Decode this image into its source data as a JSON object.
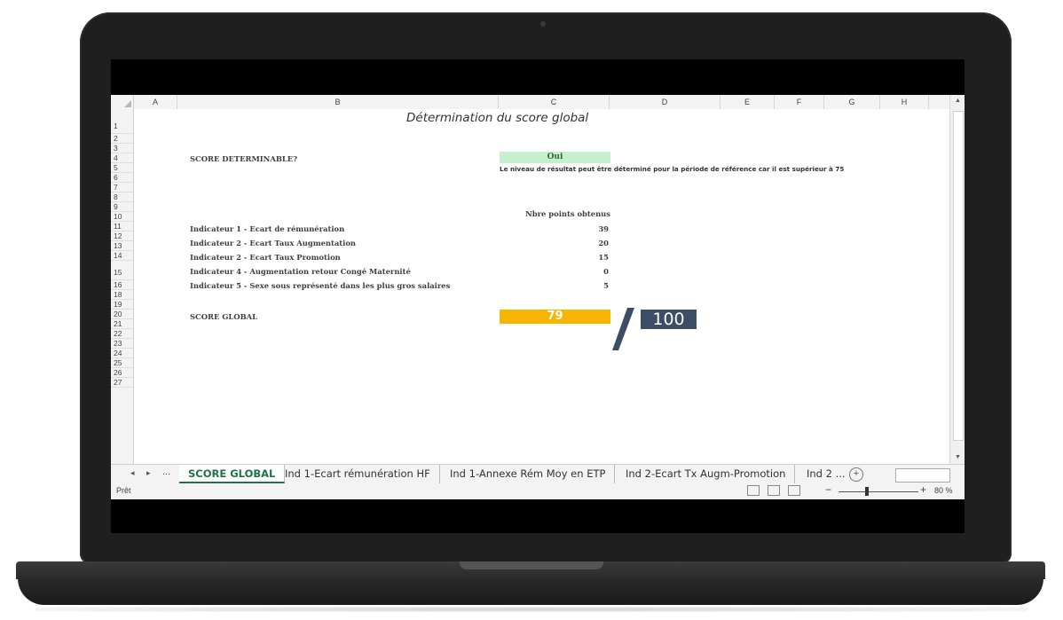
{
  "sheet": {
    "title": "Détermination du score global",
    "columns": [
      "A",
      "B",
      "C",
      "D",
      "E",
      "F",
      "G",
      "H"
    ],
    "rows": [
      "1",
      "2",
      "3",
      "4",
      "5",
      "6",
      "7",
      "8",
      "9",
      "10",
      "11",
      "12",
      "13",
      "14",
      "15",
      "16",
      "18",
      "19",
      "20",
      "21",
      "22",
      "23",
      "24",
      "25",
      "26",
      "27"
    ]
  },
  "determinable": {
    "label": "SCORE DETERMINABLE?",
    "value": "Oui",
    "note": "Le niveau de résultat peut être déterminé pour la période de référence car il est supérieur à 75"
  },
  "points": {
    "header": "Nbre points obtenus",
    "rows": [
      {
        "label": "Indicateur 1 - Ecart de rémunération",
        "value": "39"
      },
      {
        "label": "Indicateur 2 - Ecart Taux Augmentation",
        "value": "20"
      },
      {
        "label": "Indicateur 2 - Ecart Taux Promotion",
        "value": "15"
      },
      {
        "label": "Indicateur 4 - Augmentation retour Congé Maternité",
        "value": "0"
      },
      {
        "label": "Indicateur 5 - Sexe sous représenté dans les plus gros salaires",
        "value": "5"
      }
    ]
  },
  "score": {
    "label": "SCORE GLOBAL",
    "value": "79",
    "max": "100",
    "color": "#f7b500",
    "max_color": "#3c4e63"
  },
  "sheet_tabs": {
    "nav_prev": "◂",
    "nav_next": "▸",
    "nav_more": "...",
    "tabs": [
      "SCORE GLOBAL",
      "Ind 1-Ecart rémunération HF",
      "Ind 1-Annexe Rém Moy en ETP",
      "Ind 2-Ecart Tx Augm-Promotion",
      "Ind 2 ..."
    ],
    "add": "+"
  },
  "status": {
    "ready": "Prêt",
    "zoom_minus": "−",
    "zoom_plus": "+",
    "zoom": "80 %"
  },
  "theme": {
    "accent": "#217346",
    "oui_bg": "#c6efce"
  }
}
